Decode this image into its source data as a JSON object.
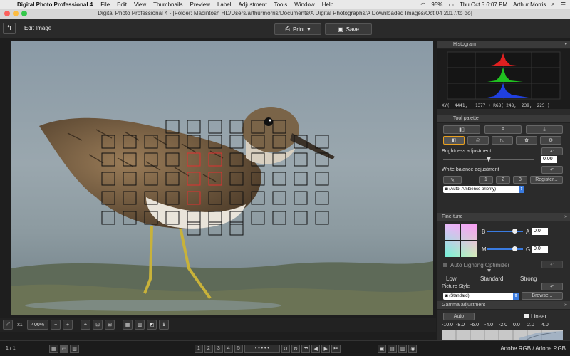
{
  "menubar": {
    "app_name": "Digital Photo Professional 4",
    "menus": [
      "File",
      "Edit",
      "View",
      "Thumbnails",
      "Preview",
      "Label",
      "Adjustment",
      "Tools",
      "Window",
      "Help"
    ],
    "battery": "95%",
    "clock": "Thu Oct 5  6:07 PM",
    "user": "Arthur Morris"
  },
  "window": {
    "title": "Digital Photo Professional 4 - [Folder: Macintosh HD/Users/arthurmorris/Documents/A Digital Photographs/A Downloaded Images/Oct 04 2017/to do]"
  },
  "toolbar": {
    "mode_label": "Edit Image",
    "print_label": "Print",
    "save_label": "Save"
  },
  "viewbar": {
    "zoom_1x": "x1",
    "zoom_value": "400%"
  },
  "statusbar": {
    "page": "1 / 1",
    "ratings": [
      "1",
      "2",
      "3",
      "4",
      "5"
    ],
    "profile": "Adobe RGB / Adobe RGB"
  },
  "histogram": {
    "title": "Histogram",
    "readout": "XY(  4441,   1377 ) RGB( 248,  239,  225 )"
  },
  "tool_palette": {
    "title": "Tool palette",
    "brightness": {
      "label": "Brightness adjustment",
      "value": "0.00",
      "level": 0.5
    },
    "white_balance": {
      "label": "White balance adjustment",
      "presets": [
        "1",
        "2",
        "3"
      ],
      "register": "Register...",
      "mode": "(Auto: Ambience priority)"
    }
  },
  "fine_tune": {
    "title": "Fine-tune",
    "b_label": "B",
    "a_label": "A",
    "a_value": "0.0",
    "b_level": 0.5,
    "m_label": "M",
    "g_label": "G",
    "g_value": "0.0",
    "m_level": 0.5,
    "alo_label": "Auto Lighting Optimizer",
    "alo_levels": [
      "Low",
      "Standard",
      "Strong"
    ],
    "picture_style_label": "Picture Style",
    "picture_style_value": "(Standard)",
    "browse": "Browse..."
  },
  "gamma": {
    "title": "Gamma adjustment",
    "auto": "Auto",
    "linear": "Linear",
    "scale": [
      "-10.0",
      "-8.0",
      "-6.0",
      "-4.0",
      "-2.0",
      "0.0",
      "2.0",
      "4.0"
    ]
  },
  "colors": {
    "accent": "#3a7be0",
    "af_active": "#e03030",
    "af_inactive": "#111111"
  }
}
